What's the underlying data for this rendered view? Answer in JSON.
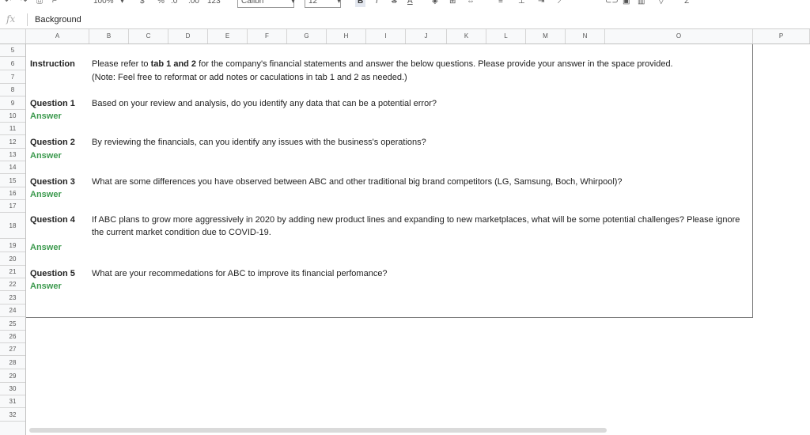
{
  "toolbar": {
    "zoom": "100%",
    "currency": "$",
    "percent": "%",
    "decimal_less": ".0",
    "decimal_more": ".00",
    "format_more": "123",
    "font_family": "Calibri",
    "font_size": "12",
    "bold": "B",
    "italic": "I",
    "strike": "S",
    "text_color": "A",
    "function": "Σ"
  },
  "formula_bar": {
    "fx": "fx",
    "value": "Background"
  },
  "columns": [
    "A",
    "B",
    "C",
    "D",
    "E",
    "F",
    "G",
    "H",
    "I",
    "J",
    "K",
    "L",
    "M",
    "N",
    "O",
    "P"
  ],
  "rows": [
    "5",
    "6",
    "7",
    "8",
    "9",
    "10",
    "11",
    "12",
    "13",
    "14",
    "15",
    "16",
    "17",
    "18",
    "19",
    "20",
    "21",
    "22",
    "23",
    "24",
    "25",
    "26",
    "27",
    "28",
    "29",
    "30",
    "31",
    "32"
  ],
  "sheet": {
    "instruction_label": "Instruction",
    "instruction_pre": "Please refer to ",
    "instruction_bold": "tab 1 and 2",
    "instruction_post": " for the company's financial statements and answer the below questions. Please provide your answer in the space provided.",
    "instruction_note": "(Note: Feel free to reformat or add notes or caculations in tab 1 and 2 as needed.)",
    "questions": [
      {
        "label": "Question 1",
        "text": "Based on your review and analysis, do you identify any data that can be a potential error?",
        "answer": "Answer"
      },
      {
        "label": "Question 2",
        "text": "By reviewing the financials, can you identify any issues with the business's operations?",
        "answer": "Answer"
      },
      {
        "label": "Question 3",
        "text": "What are some differences you have observed between ABC and other traditional big brand competitors (LG, Samsung, Boch, Whirpool)?",
        "answer": "Answer"
      },
      {
        "label": "Question 4",
        "text": "If ABC plans to grow more aggressively in 2020 by adding new product lines and expanding to new marketplaces, what will be some potential challenges? Please ignore",
        "text2": "the current market condition due to COVID-19.",
        "answer": "Answer"
      },
      {
        "label": "Question 5",
        "text": "What are your recommedations for ABC to improve its financial perfomance?",
        "answer": "Answer"
      }
    ]
  },
  "colors": {
    "answer_green": "#3c9a4e",
    "header_bg": "#f8f9fa"
  }
}
